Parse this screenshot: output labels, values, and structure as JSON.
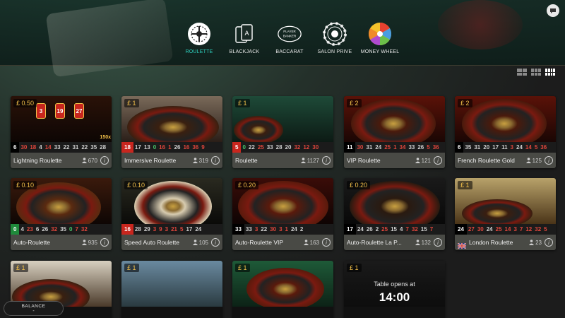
{
  "nav": {
    "items": [
      {
        "label": "ROULETTE",
        "icon": "roulette-icon",
        "active": true
      },
      {
        "label": "BLACKJACK",
        "icon": "blackjack-cards-icon",
        "active": false
      },
      {
        "label": "BACCARAT",
        "icon": "baccarat-icon",
        "active": false
      },
      {
        "label": "SALON PRIVE",
        "icon": "salon-prive-chip-icon",
        "active": false
      },
      {
        "label": "MONEY WHEEL",
        "icon": "money-wheel-icon",
        "active": false
      }
    ],
    "baccarat_icon_text": [
      "PLAYER",
      "BANKER"
    ],
    "chat_icon": "chat-icon"
  },
  "view_toggles": [
    "grid-large-icon",
    "grid-medium-icon",
    "grid-small-icon"
  ],
  "colors": {
    "accent": "#2fd3c2",
    "bet": "#f3c14a",
    "red": "#c8261e",
    "green": "#1f8a3b"
  },
  "tables": [
    {
      "bet": "£ 0.50",
      "name": "Lightning Roulette",
      "players": "670",
      "lightning": [
        "3",
        "19",
        "27"
      ],
      "multiplier": "150x",
      "results": [
        [
          "6",
          "b"
        ],
        [
          "30",
          "r"
        ],
        [
          "18",
          "r"
        ],
        [
          "4",
          "b"
        ],
        [
          "14",
          "r"
        ],
        [
          "33",
          "b"
        ],
        [
          "22",
          "b"
        ],
        [
          "31",
          "b"
        ],
        [
          "22",
          "b"
        ],
        [
          "35",
          "b"
        ],
        [
          "28",
          "b"
        ]
      ]
    },
    {
      "bet": "£ 1",
      "name": "Immersive Roulette",
      "players": "319",
      "results": [
        [
          "18",
          "r"
        ],
        [
          "17",
          "b"
        ],
        [
          "13",
          "b"
        ],
        [
          "0",
          "g"
        ],
        [
          "16",
          "r"
        ],
        [
          "1",
          "r"
        ],
        [
          "26",
          "b"
        ],
        [
          "16",
          "r"
        ],
        [
          "36",
          "r"
        ],
        [
          "9",
          "r"
        ]
      ]
    },
    {
      "bet": "£ 1",
      "name": "Roulette",
      "players": "1127",
      "results": [
        [
          "5",
          "r"
        ],
        [
          "0",
          "g"
        ],
        [
          "22",
          "b"
        ],
        [
          "25",
          "r"
        ],
        [
          "33",
          "b"
        ],
        [
          "28",
          "b"
        ],
        [
          "20",
          "b"
        ],
        [
          "32",
          "r"
        ],
        [
          "12",
          "r"
        ],
        [
          "30",
          "r"
        ]
      ]
    },
    {
      "bet": "£ 2",
      "name": "VIP Roulette",
      "players": "121",
      "results": [
        [
          "11",
          "b"
        ],
        [
          "30",
          "r"
        ],
        [
          "31",
          "b"
        ],
        [
          "24",
          "b"
        ],
        [
          "25",
          "r"
        ],
        [
          "1",
          "r"
        ],
        [
          "34",
          "r"
        ],
        [
          "33",
          "b"
        ],
        [
          "26",
          "b"
        ],
        [
          "5",
          "r"
        ],
        [
          "36",
          "r"
        ]
      ]
    },
    {
      "bet": "£ 2",
      "name": "French Roulette Gold",
      "players": "125",
      "results": [
        [
          "6",
          "b"
        ],
        [
          "35",
          "b"
        ],
        [
          "31",
          "b"
        ],
        [
          "20",
          "b"
        ],
        [
          "17",
          "b"
        ],
        [
          "11",
          "b"
        ],
        [
          "3",
          "r"
        ],
        [
          "24",
          "b"
        ],
        [
          "14",
          "r"
        ],
        [
          "5",
          "r"
        ],
        [
          "36",
          "r"
        ]
      ]
    },
    {
      "bet": "£ 0.10",
      "name": "Auto-Roulette",
      "players": "935",
      "results": [
        [
          "0",
          "g"
        ],
        [
          "4",
          "b"
        ],
        [
          "23",
          "r"
        ],
        [
          "6",
          "b"
        ],
        [
          "26",
          "b"
        ],
        [
          "32",
          "r"
        ],
        [
          "35",
          "b"
        ],
        [
          "0",
          "g"
        ],
        [
          "7",
          "r"
        ],
        [
          "32",
          "r"
        ]
      ]
    },
    {
      "bet": "£ 0.10",
      "name": "Speed Auto Roulette",
      "players": "105",
      "results": [
        [
          "16",
          "r"
        ],
        [
          "28",
          "b"
        ],
        [
          "29",
          "b"
        ],
        [
          "3",
          "r"
        ],
        [
          "9",
          "r"
        ],
        [
          "3",
          "r"
        ],
        [
          "21",
          "r"
        ],
        [
          "5",
          "r"
        ],
        [
          "17",
          "b"
        ],
        [
          "24",
          "b"
        ]
      ]
    },
    {
      "bet": "£ 0.20",
      "name": "Auto-Roulette VIP",
      "players": "163",
      "results": [
        [
          "33",
          "b"
        ],
        [
          "33",
          "b"
        ],
        [
          "3",
          "r"
        ],
        [
          "22",
          "b"
        ],
        [
          "30",
          "r"
        ],
        [
          "3",
          "r"
        ],
        [
          "1",
          "r"
        ],
        [
          "24",
          "b"
        ],
        [
          "2",
          "b"
        ]
      ]
    },
    {
      "bet": "£ 0.20",
      "name": "Auto-Roulette La P...",
      "players": "132",
      "results": [
        [
          "17",
          "b"
        ],
        [
          "24",
          "b"
        ],
        [
          "26",
          "b"
        ],
        [
          "2",
          "b"
        ],
        [
          "25",
          "r"
        ],
        [
          "15",
          "b"
        ],
        [
          "4",
          "b"
        ],
        [
          "7",
          "r"
        ],
        [
          "32",
          "r"
        ],
        [
          "15",
          "b"
        ],
        [
          "7",
          "r"
        ]
      ]
    },
    {
      "bet": "£ 1",
      "name": "London Roulette",
      "players": "23",
      "flag": "uk-flag-icon",
      "results": [
        [
          "24",
          "b"
        ],
        [
          "27",
          "r"
        ],
        [
          "30",
          "r"
        ],
        [
          "24",
          "b"
        ],
        [
          "25",
          "r"
        ],
        [
          "14",
          "r"
        ],
        [
          "3",
          "r"
        ],
        [
          "7",
          "r"
        ],
        [
          "12",
          "r"
        ],
        [
          "32",
          "r"
        ],
        [
          "5",
          "r"
        ]
      ]
    },
    {
      "bet": "£ 1",
      "name": "",
      "players": "",
      "results": []
    },
    {
      "bet": "£ 1",
      "name": "",
      "players": "",
      "results": []
    },
    {
      "bet": "£ 1",
      "name": "",
      "players": "",
      "results": []
    },
    {
      "bet": "£ 1",
      "name": "",
      "players": "",
      "opens_label": "Table opens at",
      "opens_time": "14:00",
      "results": []
    }
  ],
  "balance": {
    "label": "BALANCE",
    "value": "-"
  }
}
